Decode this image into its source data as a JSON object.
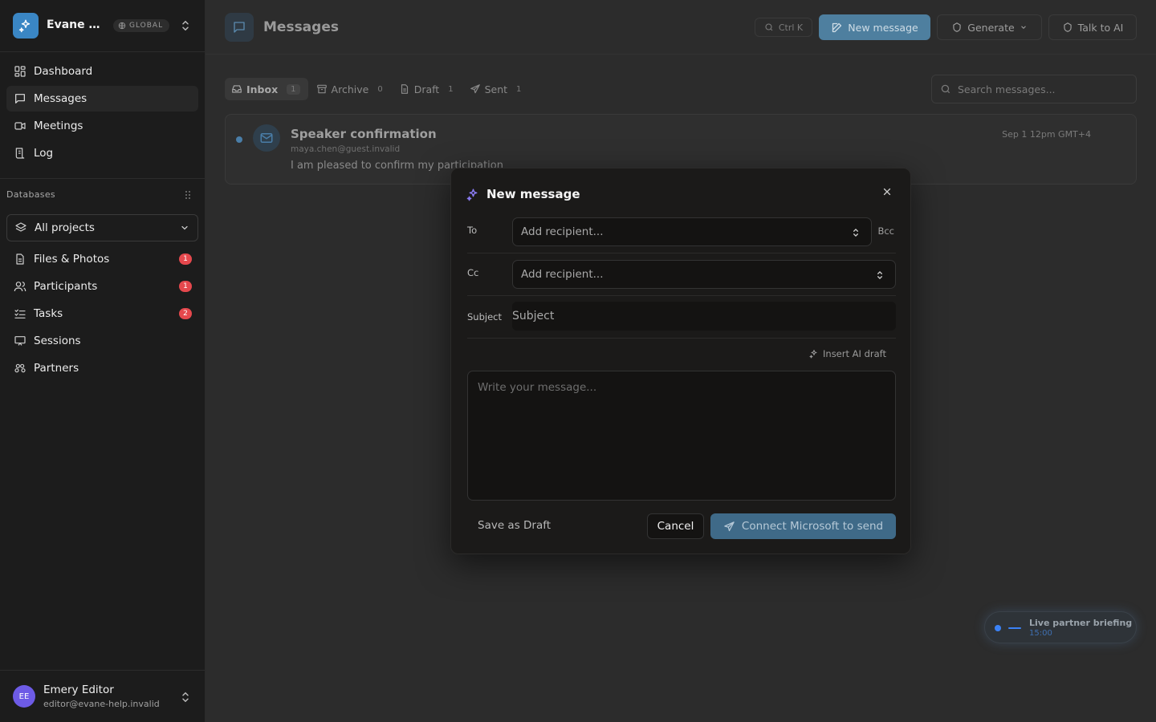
{
  "workspace": {
    "name": "Evane Help",
    "badge": "GLOBAL"
  },
  "nav": [
    {
      "label": "Dashboard",
      "icon": "dashboard-icon"
    },
    {
      "label": "Messages",
      "icon": "message-icon",
      "active": true
    },
    {
      "label": "Meetings",
      "icon": "video-icon"
    },
    {
      "label": "Log",
      "icon": "log-icon"
    }
  ],
  "databases": {
    "label": "Databases",
    "selector": "All projects",
    "items": [
      {
        "label": "Files & Photos",
        "count": "1"
      },
      {
        "label": "Participants",
        "count": "1"
      },
      {
        "label": "Tasks",
        "count": "2"
      },
      {
        "label": "Sessions"
      },
      {
        "label": "Partners"
      }
    ]
  },
  "user": {
    "initials": "EE",
    "name": "Emery Editor",
    "email": "editor@evane-help.invalid"
  },
  "page": {
    "title": "Messages",
    "search_shortcut": "Ctrl K",
    "new_message": "New message",
    "generate": "Generate",
    "talk_ai": "Talk to AI"
  },
  "tabs": [
    {
      "label": "Inbox",
      "count": "1",
      "active": true
    },
    {
      "label": "Archive",
      "count": "0"
    },
    {
      "label": "Draft",
      "count": "1"
    },
    {
      "label": "Sent",
      "count": "1"
    }
  ],
  "search": {
    "placeholder": "Search messages..."
  },
  "message": {
    "subject": "Speaker confirmation",
    "from": "maya.chen@guest.invalid",
    "preview": "I am pleased to confirm my participation",
    "time": "Sep 1 12pm GMT+4"
  },
  "live": {
    "title": "Live partner briefing",
    "time": "15:00"
  },
  "modal": {
    "title": "New message",
    "to_label": "To",
    "cc_label": "Cc",
    "bcc_label": "Bcc",
    "subject_label": "Subject",
    "recipient_placeholder": "Add recipient...",
    "subject_placeholder": "Subject",
    "insert_ai": "Insert AI draft",
    "body_placeholder": "Write your message...",
    "save_draft": "Save as Draft",
    "cancel": "Cancel",
    "send": "Connect Microsoft to send"
  },
  "colors": {
    "accent": "#3a86c4",
    "badge": "#e5484d",
    "avatar": "#6d5be6"
  }
}
